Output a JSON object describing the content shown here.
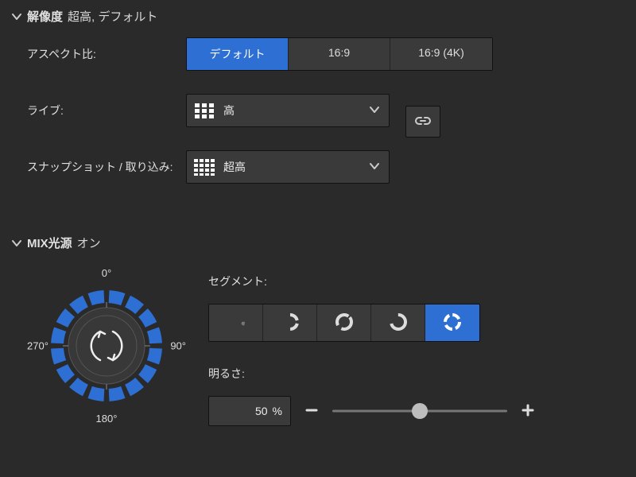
{
  "resolution": {
    "title": "解像度",
    "status": "超高, デフォルト",
    "aspect_label": "アスペクト比:",
    "aspect_options": [
      "デフォルト",
      "16:9",
      "16:9 (4K)"
    ],
    "aspect_selected": 0,
    "live_label": "ライブ:",
    "live_value": "高",
    "snapshot_label": "スナップショット / 取り込み:",
    "snapshot_value": "超高"
  },
  "mix": {
    "title": "MIX光源",
    "status": "オン",
    "dial_ticks": {
      "top": "0°",
      "right": "90°",
      "bottom": "180°",
      "left": "270°"
    },
    "segment_label": "セグメント:",
    "segment_selected": 4,
    "brightness_label": "明るさ:",
    "brightness_value": "50",
    "brightness_unit": "%",
    "brightness_percent": 50
  },
  "colors": {
    "accent": "#2d6fd2"
  }
}
